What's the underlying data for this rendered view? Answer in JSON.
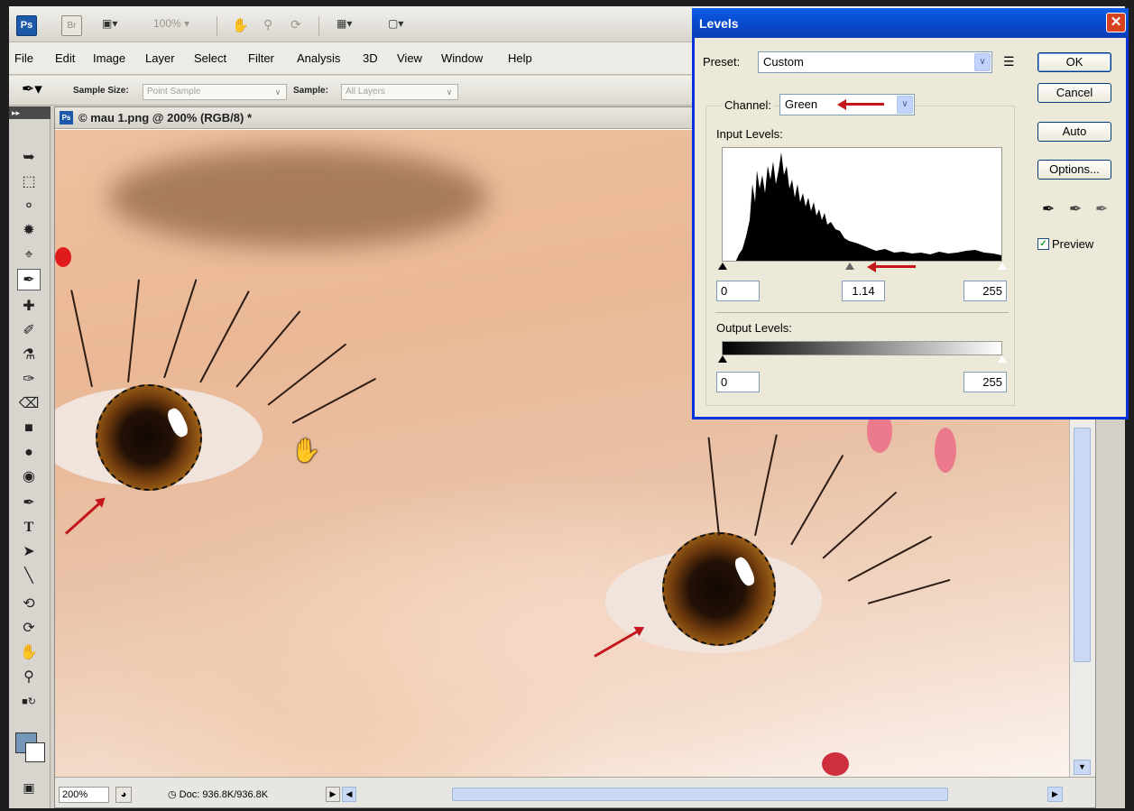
{
  "appbar": {
    "ps_logo": "Ps",
    "br_logo": "Br",
    "zoom": "100%",
    "icons": [
      "film-icon",
      "hand-icon",
      "zoom-icon",
      "rotate-icon",
      "arrange-icon",
      "screen-mode-icon"
    ]
  },
  "menu": [
    "File",
    "Edit",
    "Image",
    "Layer",
    "Select",
    "Filter",
    "Analysis",
    "3D",
    "View",
    "Window",
    "Help"
  ],
  "options_bar": {
    "sample_size_label": "Sample Size:",
    "sample_size_value": "Point Sample",
    "sample_label": "Sample:",
    "sample_value": "All Layers"
  },
  "document": {
    "title": "© mau 1.png @ 200% (RGB/8) *",
    "zoom": "200%",
    "doc_info": "Doc: 936.8K/936.8K"
  },
  "levels_dialog": {
    "title": "Levels",
    "preset_label": "Preset:",
    "preset_value": "Custom",
    "channel_label": "Channel:",
    "channel_value": "Green",
    "input_levels_label": "Input Levels:",
    "input_black": "0",
    "input_gamma": "1.14",
    "input_white": "255",
    "output_levels_label": "Output Levels:",
    "output_black": "0",
    "output_white": "255",
    "ok_label": "OK",
    "cancel_label": "Cancel",
    "auto_label": "Auto",
    "options_label": "Options...",
    "preview_label": "Preview",
    "preview_checked": true
  },
  "colors": {
    "foreground": "#7596b6",
    "background": "#ffffff",
    "title_bar": "#0a5ee6",
    "annotation_arrow": "#c3171c"
  }
}
